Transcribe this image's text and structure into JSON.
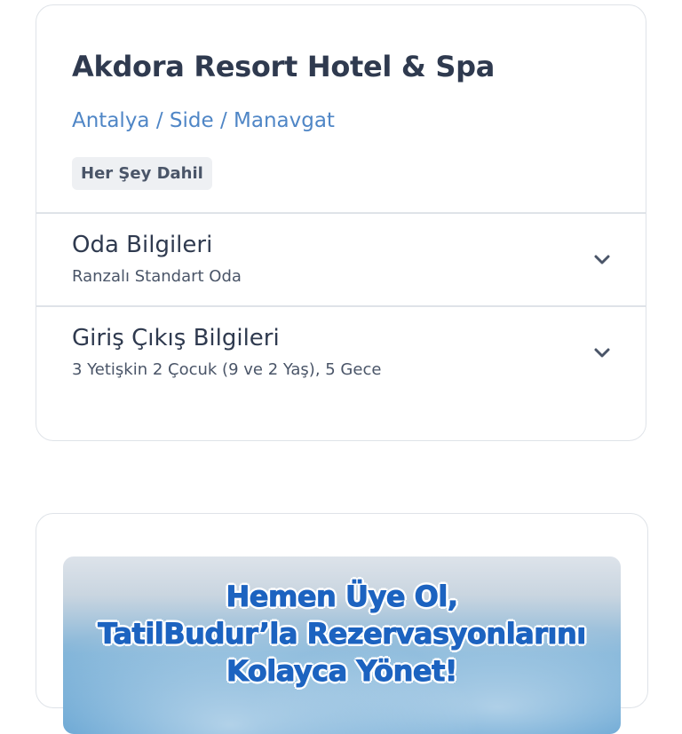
{
  "hotel": {
    "name": "Akdora Resort Hotel & Spa",
    "location": "Antalya / Side / Manavgat",
    "board_type": "Her Şey Dahil"
  },
  "sections": [
    {
      "title": "Oda Bilgileri",
      "subtitle": "Ranzalı Standart Oda",
      "icon": "chevron-down-icon"
    },
    {
      "title": "Giriş Çıkış Bilgileri",
      "subtitle": "3 Yetişkin 2 Çocuk (9 ve 2 Yaş), 5 Gece",
      "icon": "chevron-down-icon"
    }
  ],
  "promo": {
    "lines": [
      "Hemen Üye Ol,",
      "TatilBudur’la Rezervasyonlarını",
      "Kolayca Yönet!"
    ]
  },
  "colors": {
    "title": "#2f3a4f",
    "location_link": "#4f86c6",
    "badge_bg": "#eef0f3",
    "border": "#dfe3e8",
    "promo_text": "#1c63c0"
  }
}
